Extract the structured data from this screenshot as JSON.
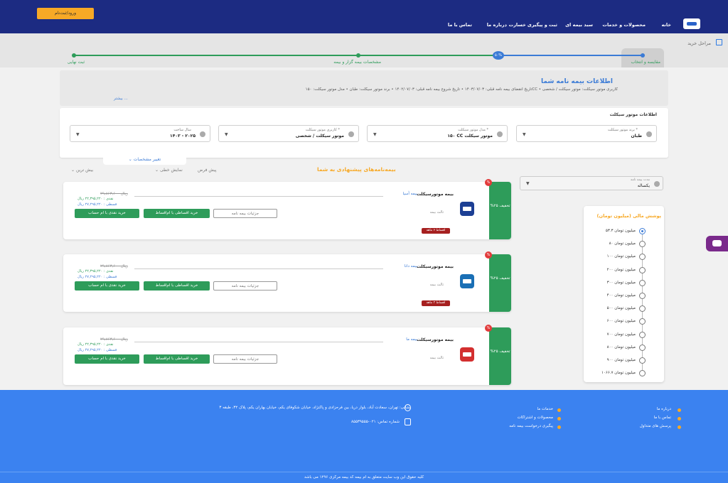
{
  "header": {
    "login": "ورود/ثبت‌نام",
    "nav": [
      "خانه",
      "محصولات و خدمات",
      "سبد بیمه ای",
      "ثبت و پیگیری خسارت",
      "درباره ما",
      "تماس با ما"
    ]
  },
  "steps": {
    "title": "مراحل خرید",
    "items": [
      "مقایسه و انتخاب",
      "مشخصات بیمه گزار و بیمه",
      "ثبت نهایی"
    ],
    "percent": "۵۰%"
  },
  "info": {
    "title": "اطلاعات بیمه نامه شما",
    "details": "تاریخ انقضای بیمه نامه قبلی: ۱۴۰۳/۰۷/۰۳  •  تاریخ شروع بیمه نامه قبلی: ۱۴۰۲/۰۷/۰۳  •  برند موتور سیکلت: طبان  •  مدل موتور سیکلت: ۱۵۰CC  •  کاربری موتور سیکلت: موتور سیکلت / شخصی",
    "more": "بیشتر ..."
  },
  "car": {
    "title": "اطلاعات موتور سیکلت",
    "fields": [
      {
        "label": "برند موتور سیکلت *",
        "value": "طبان"
      },
      {
        "label": "مدل موتور سیکلت *",
        "value": "۱۵۰ CC موتور سیکلت"
      },
      {
        "label": "کاربری موتور سیکلت *",
        "value": "موتور سیکلت / شخصی"
      },
      {
        "label": "سال ساخت",
        "value": "۱۴۰۳ - ۲۰۲۵"
      }
    ]
  },
  "edit_tab": "تغییر مشخصات",
  "offers_title": "بیمه‌نامه‌های پیشنهادی به شما",
  "sort": [
    "بیش ترین",
    "نمایش خطی",
    "پیش فرض"
  ],
  "duration": {
    "label": "مدت بیمه نامه",
    "value": "یکساله"
  },
  "filter": {
    "title": "پوشش مالی (میلیون تومان)",
    "options": [
      "۵۳.۳ میلیون تومان",
      "۸۰ میلیون تومان",
      "۱۰۰ میلیون تومان",
      "۲۰۰ میلیون تومان",
      "۳۰۰ میلیون تومان",
      "۴۰۰ میلیون تومان",
      "۵۰۰ میلیون تومان",
      "۶۰۰ میلیون تومان",
      "۷۰۰ میلیون تومان",
      "۸۰۰ میلیون تومان",
      "۹۰۰ میلیون تومان",
      "۱۰۶۶.۷ میلیون تومان"
    ],
    "selected_index": 0
  },
  "cards": [
    {
      "name": "بیمه موتورسیکلت",
      "company": "بیمه آسیا",
      "info": "ثالث بیمه",
      "branch": "اقساط ۶ ماهه",
      "discount": "%۲۵ تخفیف",
      "price_old": "۲۹,۸۶۳,۶۰۰ ریال",
      "price_cash": "نقدی : ۲۲,۳۹۵,۲۲۰ ریال",
      "price_inst": "قسطی : ۲۷,۲۹۵,۲۲۰ ریال",
      "btn_detail": "جزئیات بیمه نامه",
      "btn_inst": "خرید اقساطی با ام‌اقساط",
      "btn_cash": "خرید نقدی با ام حساب",
      "logo_color": "#1c3f94"
    },
    {
      "name": "بیمه موتورسیکلت",
      "company": "بیمه دانا",
      "info": "ثالث بیمه",
      "branch": "اقساط ۳ ماهه",
      "discount": "%۲۵ تخفیف",
      "price_old": "۲۹,۸۶۳,۶۰۰ ریال",
      "price_cash": "نقدی : ۲۲,۳۹۵,۲۲۰ ریال",
      "price_inst": "قسطی : ۲۷,۲۹۵,۲۲۰ ریال",
      "btn_detail": "جزئیات بیمه نامه",
      "btn_inst": "خرید اقساطی با ام‌اقساط",
      "btn_cash": "خرید نقدی با ام حساب",
      "logo_color": "#1a6fb5"
    },
    {
      "name": "بیمه موتورسیکلت",
      "company": "بیمه ما",
      "info": "ثالث بیمه",
      "branch": "",
      "discount": "%۲۵ تخفیف",
      "price_old": "۲۹,۸۶۳,۶۰۰ ریال",
      "price_cash": "نقدی : ۲۲,۳۹۵,۲۲۰ ریال",
      "price_inst": "قسطی : ۲۷,۲۹۵,۲۲۰ ریال",
      "btn_detail": "جزئیات بیمه نامه",
      "btn_inst": "خرید اقساطی با ام‌اقساط",
      "btn_cash": "خرید نقدی با ام حساب",
      "logo_color": "#d32f2f"
    }
  ],
  "footer": {
    "col1": [
      "درباره ما",
      "تماس با ما",
      "پرسش های متداول"
    ],
    "col2": [
      "خدمات ما",
      "محصولات و اشتراکات",
      "پیگیری درخواست بیمه نامه"
    ],
    "address": "نشانی: تهران، سعادت آباد، بلوار دریا، بین فرحزادی و پاکنژاد، خیابان شکوفای یکم، خیابان بهاران یکم، پلاک ۳۲، طبقه ۳",
    "phone": "شماره تماس: ۰۲۱-۸۵۵۳۹۵۵۵",
    "copyright": "کلیه حقوق این وب سایت متعلق به ام بیمه کد بیمه مرکزی ۱۲۹۶ می باشد"
  }
}
